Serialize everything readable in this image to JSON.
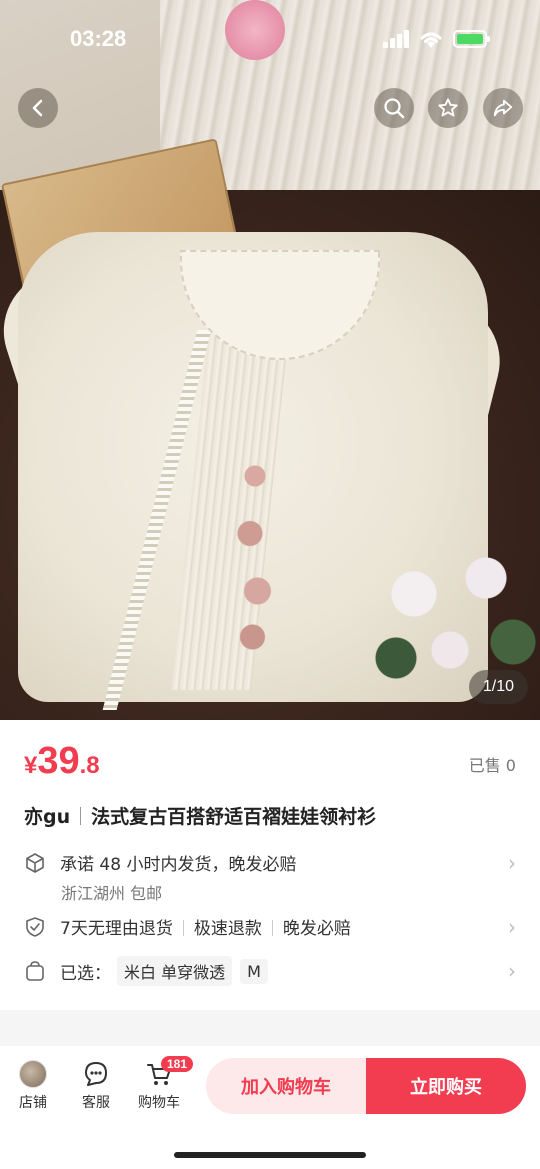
{
  "status_bar": {
    "time": "03:28"
  },
  "gallery": {
    "counter": "1/10"
  },
  "product": {
    "currency": "¥",
    "price_int": "39",
    "price_dec": ".8",
    "sold": "已售 0",
    "brand": "亦gu",
    "title": "法式复古百搭舒适百褶娃娃领衬衫"
  },
  "shipping": {
    "promise": "承诺 48 小时内发货，晚发必赔",
    "origin": "浙江湖州 包邮"
  },
  "guarantees": [
    "7天无理由退货",
    "极速退款",
    "晚发必赔"
  ],
  "selection": {
    "label": "已选：",
    "color": "米白 单穿微透",
    "size": "M"
  },
  "bottom_bar": {
    "shop_label": "店铺",
    "service_label": "客服",
    "cart_label": "购物车",
    "cart_count": "181",
    "add_to_cart": "加入购物车",
    "buy_now": "立即购买"
  },
  "colors": {
    "accent": "#f23c4f",
    "accent_light": "#fde8ea"
  },
  "icons": [
    "back-icon",
    "search-icon",
    "star-icon",
    "share-icon",
    "box-icon",
    "shield-check-icon",
    "bag-icon",
    "chat-icon",
    "cart-icon",
    "chevron-right-icon"
  ]
}
